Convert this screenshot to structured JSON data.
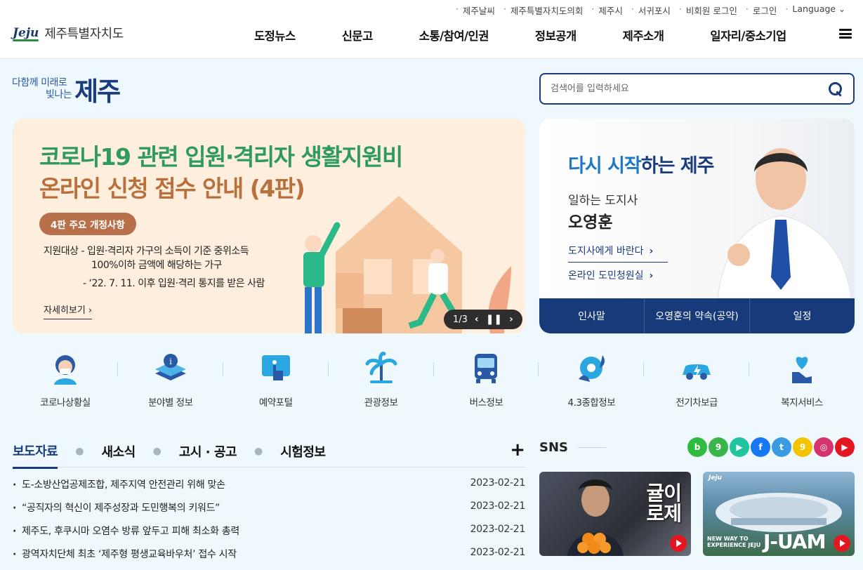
{
  "header": {
    "util_links": [
      "제주날씨",
      "제주특별자치도의회",
      "제주시",
      "서귀포시",
      "비회원 로그인",
      "로그인"
    ],
    "language": "Language",
    "logo_mark": "Jeju",
    "logo_name": "제주특별자치도",
    "nav": [
      "도정뉴스",
      "신문고",
      "소통/참여/인권",
      "정보공개",
      "제주소개",
      "일자리/중소기업"
    ]
  },
  "slogan": {
    "line1": "다함께 미래로",
    "line2": "빛나는",
    "big": "제주"
  },
  "search": {
    "placeholder": "검색어를 입력하세요"
  },
  "banner": {
    "title1": "코로나19 관련 입원·격리자 생활지원비",
    "title2": "온라인 신청 접수 안내 (4판)",
    "pill": "4판 주요 개정사항",
    "desc1": "지원대상 - 입원·격리자 가구의 소득이 기준 중위소득",
    "desc2": "100%이하 금액에 해당하는 가구",
    "desc3": "- ‘22. 7. 11. 이후 입원·격리 통지를 받은 사람",
    "more": "자세히보기 ›",
    "pager": "1/3"
  },
  "governor": {
    "headline_a": "다시 시작",
    "headline_b": "하는 제주",
    "role": "일하는 도지사",
    "name": "오영훈",
    "link1": "도지사에게 바란다",
    "link2": "온라인 도민청원실",
    "tabs": [
      "인사말",
      "오영훈의 약속(공약)",
      "일정"
    ]
  },
  "quick": [
    {
      "label": "코로나상황실",
      "icon": "mask-person-icon"
    },
    {
      "label": "분야별 정보",
      "icon": "info-layers-icon"
    },
    {
      "label": "예약포털",
      "icon": "touch-reservation-icon"
    },
    {
      "label": "관광정보",
      "icon": "palm-tree-icon"
    },
    {
      "label": "버스정보",
      "icon": "bus-icon"
    },
    {
      "label": "4.3종합정보",
      "icon": "camellia-flower-icon"
    },
    {
      "label": "전기차보급",
      "icon": "electric-car-icon"
    },
    {
      "label": "복지서비스",
      "icon": "heart-hand-icon"
    }
  ],
  "news": {
    "tabs": [
      "보도자료",
      "새소식",
      "고시 · 공고",
      "시험정보"
    ],
    "items": [
      {
        "title": "도-소방산업공제조합, 제주지역 안전관리 위해 맞손",
        "date": "2023-02-21"
      },
      {
        "title": "“공직자의 혁신이 제주성장과 도민행복의 키워드”",
        "date": "2023-02-21"
      },
      {
        "title": "제주도, 후쿠시마 오염수 방류 앞두고 피해 최소화 총력",
        "date": "2023-02-21"
      },
      {
        "title": "광역자치단체 최초 ‘제주형 평생교육바우처’ 접수 시작",
        "date": "2023-02-21"
      }
    ]
  },
  "sns": {
    "title": "SNS",
    "icons": [
      {
        "name": "band-icon",
        "glyph": "b",
        "color": "#2fbb3f"
      },
      {
        "name": "kakaostory-icon",
        "glyph": "9",
        "color": "#3ab54a"
      },
      {
        "name": "play-icon",
        "glyph": "▶",
        "color": "#22c4a0"
      },
      {
        "name": "facebook-icon",
        "glyph": "f",
        "color": "#1877f2"
      },
      {
        "name": "twitter-icon",
        "glyph": "t",
        "color": "#3a9be0"
      },
      {
        "name": "kakao-channel-icon",
        "glyph": "9",
        "color": "#f5c400"
      },
      {
        "name": "instagram-icon",
        "glyph": "◎",
        "color": "#d4336b"
      },
      {
        "name": "youtube-icon",
        "glyph": "▶",
        "color": "#e4161f"
      }
    ],
    "video1_caption": "귤이\n로제",
    "video2_small": "NEW WAY TO\nEXPERIENCE JEJU",
    "video2_big": "J-UAM",
    "video2_logo": "Jeju"
  }
}
